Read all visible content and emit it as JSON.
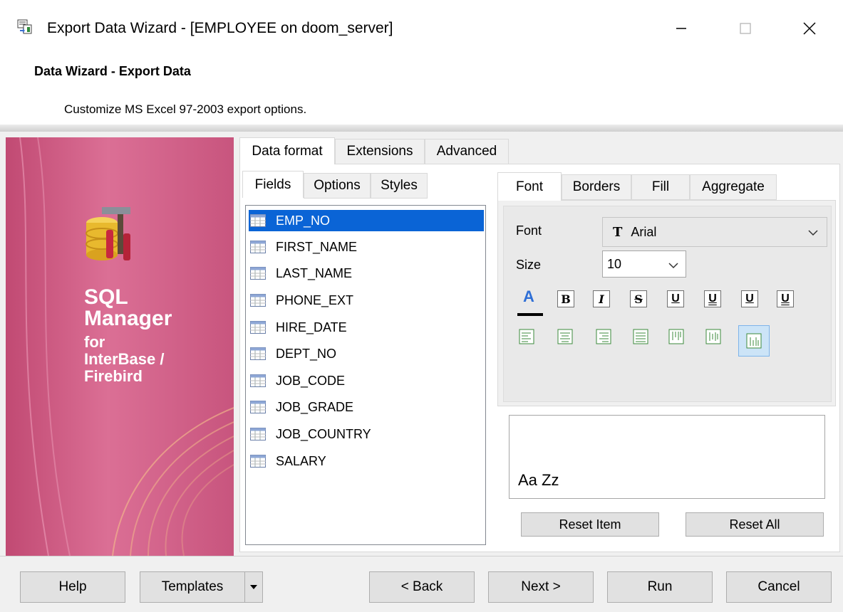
{
  "window": {
    "title": "Export Data Wizard - [EMPLOYEE on doom_server]",
    "minimize_icon": "minimize-icon",
    "maximize_icon": "maximize-icon",
    "close_icon": "close-icon"
  },
  "header": {
    "title": "Data Wizard - Export Data",
    "description": "Customize MS Excel 97-2003 export options."
  },
  "banner": {
    "line1": "SQL",
    "line2": "Manager",
    "line3": "for",
    "line4": "InterBase /",
    "line5": "Firebird"
  },
  "main_tabs": [
    {
      "label": "Data format",
      "active": true
    },
    {
      "label": "Extensions",
      "active": false
    },
    {
      "label": "Advanced",
      "active": false
    }
  ],
  "sub_tabs": [
    {
      "label": "Fields",
      "active": true
    },
    {
      "label": "Options",
      "active": false
    },
    {
      "label": "Styles",
      "active": false
    }
  ],
  "fields": [
    {
      "name": "EMP_NO",
      "selected": true
    },
    {
      "name": "FIRST_NAME",
      "selected": false
    },
    {
      "name": "LAST_NAME",
      "selected": false
    },
    {
      "name": "PHONE_EXT",
      "selected": false
    },
    {
      "name": "HIRE_DATE",
      "selected": false
    },
    {
      "name": "DEPT_NO",
      "selected": false
    },
    {
      "name": "JOB_CODE",
      "selected": false
    },
    {
      "name": "JOB_GRADE",
      "selected": false
    },
    {
      "name": "JOB_COUNTRY",
      "selected": false
    },
    {
      "name": "SALARY",
      "selected": false
    }
  ],
  "style_tabs": [
    {
      "label": "Font",
      "active": true
    },
    {
      "label": "Borders",
      "active": false
    },
    {
      "label": "Fill",
      "active": false
    },
    {
      "label": "Aggregate",
      "active": false
    }
  ],
  "font": {
    "font_label": "Font",
    "font_value": "Arial",
    "size_label": "Size",
    "size_value": "10",
    "color_glyph": "A",
    "style_buttons": [
      "B",
      "I",
      "S",
      "U",
      "U",
      "U",
      "U"
    ],
    "preview_text": "Aa Zz",
    "reset_item": "Reset Item",
    "reset_all": "Reset All"
  },
  "footer": {
    "help": "Help",
    "templates": "Templates",
    "back": "< Back",
    "next": "Next >",
    "run": "Run",
    "cancel": "Cancel"
  },
  "colors": {
    "selection": "#0a64d6",
    "banner": "#d2668d",
    "panel_bg": "#f0f0f0"
  }
}
